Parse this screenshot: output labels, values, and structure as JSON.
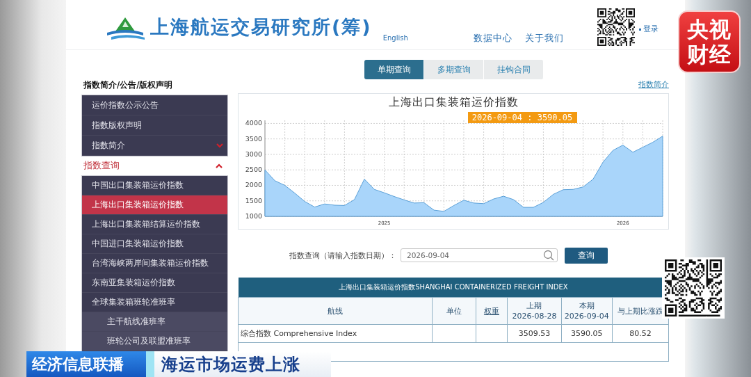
{
  "header": {
    "site_title": "上海航运交易研究所(筹)",
    "language_link": "English",
    "nav": [
      "数据中心",
      "关于我们"
    ],
    "login_link": "登录"
  },
  "tabs": [
    {
      "label": "单期查询",
      "selected": true
    },
    {
      "label": "多期查询",
      "selected": false
    },
    {
      "label": "挂钩合同",
      "selected": false
    }
  ],
  "sidebar": {
    "sections": [
      {
        "title": "指数简介/公告/版权声明",
        "items": [
          {
            "label": "运价指数公示公告",
            "selected": false
          },
          {
            "label": "指数版权声明",
            "selected": false
          },
          {
            "label": "指数简介",
            "selected": false,
            "expanded": false
          }
        ]
      },
      {
        "title": "指数查询",
        "expanded": true,
        "items": [
          {
            "label": "中国出口集装箱运价指数",
            "selected": false
          },
          {
            "label": "上海出口集装箱运价指数",
            "selected": true
          },
          {
            "label": "上海出口集装箱结算运价指数",
            "selected": false
          },
          {
            "label": "中国进口集装箱运价指数",
            "selected": false
          },
          {
            "label": "台湾海峡两岸间集装箱运价指数",
            "selected": false
          },
          {
            "label": "东南亚集装箱运价指数",
            "selected": false
          },
          {
            "label": "全球集装箱班轮准班率",
            "selected": false,
            "children": [
              {
                "label": "主干航线准班率",
                "selected": false
              },
              {
                "label": "班轮公司及联盟准班率",
                "selected": false
              }
            ]
          }
        ]
      }
    ]
  },
  "intro_link": "指数简介",
  "chart": {
    "title": "上海出口集装箱运价指数",
    "chart_data": {
      "type": "area",
      "categories": [
        null,
        null,
        null,
        null,
        null,
        null,
        null,
        null,
        null,
        null,
        null,
        null,
        "2025",
        null,
        null,
        null,
        null,
        null,
        null,
        null,
        null,
        null,
        null,
        null,
        null,
        null,
        null,
        null,
        null,
        null,
        null,
        null,
        null,
        null,
        null,
        null,
        "2026",
        null,
        null,
        null,
        null
      ],
      "values": [
        2500,
        2150,
        2000,
        1750,
        1480,
        1300,
        1400,
        1360,
        1350,
        1540,
        2200,
        1870,
        1760,
        1640,
        1530,
        1430,
        1440,
        1200,
        1160,
        1350,
        1520,
        1430,
        1410,
        1560,
        1650,
        1540,
        1290,
        1290,
        1450,
        1710,
        1860,
        1870,
        1950,
        2200,
        2750,
        3130,
        3300,
        3070,
        3230,
        3390,
        3590
      ],
      "grid": true,
      "ylim": [
        1000,
        4100
      ],
      "yticks": [
        1000,
        1500,
        2000,
        2500,
        3000,
        3500,
        4000
      ],
      "annotations": [
        {
          "text": "2026-09-04 : 3590.05"
        }
      ]
    }
  },
  "query": {
    "label": "指数查询（请输入指数日期）：",
    "value": "2026-09-04",
    "button": "查询"
  },
  "table": {
    "title": "上海出口集装箱运价指数SHANGHAI CONTAINERIZED FREIGHT INDEX",
    "columns": [
      {
        "lines": [
          "航线"
        ],
        "link": false
      },
      {
        "lines": [
          "单位"
        ],
        "link": false
      },
      {
        "lines": [
          "权重"
        ],
        "link": true
      },
      {
        "lines": [
          "上期",
          "2026-08-28"
        ],
        "link": false
      },
      {
        "lines": [
          "本期",
          "2026-09-04"
        ],
        "link": false
      },
      {
        "lines": [
          "与上期比涨跌"
        ],
        "link": false
      }
    ],
    "rows": [
      {
        "route": "综合指数 Comprehensive Index",
        "previous": "3509.53",
        "current": "3590.05",
        "change": "80.52"
      }
    ]
  },
  "overlay": {
    "badge_lines": [
      "央视",
      "财经"
    ],
    "caption": {
      "program": "经济信息联播",
      "headline": "海运市场运费上涨"
    }
  }
}
